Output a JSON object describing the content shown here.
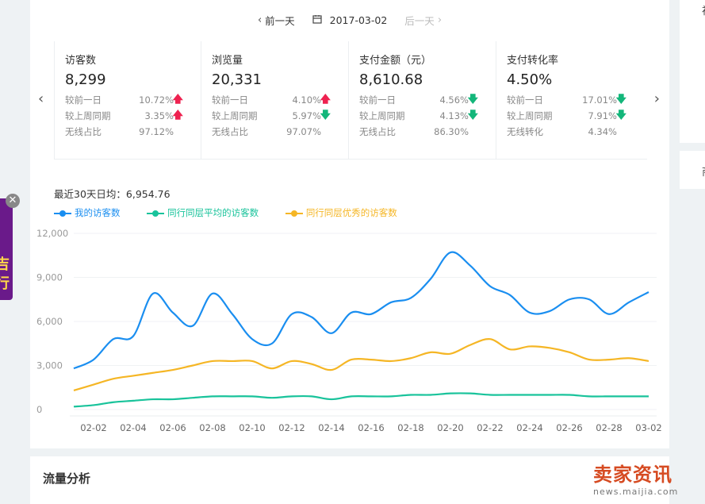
{
  "datenav": {
    "prev": "前一天",
    "date": "2017-03-02",
    "next": "后一天"
  },
  "kpis": [
    {
      "title": "访客数",
      "value": "8,299",
      "rows": [
        {
          "label": "较前一日",
          "value": "10.72%",
          "dir": "up"
        },
        {
          "label": "较上周同期",
          "value": "3.35%",
          "dir": "up"
        },
        {
          "label": "无线占比",
          "value": "97.12%",
          "dir": ""
        }
      ]
    },
    {
      "title": "浏览量",
      "value": "20,331",
      "rows": [
        {
          "label": "较前一日",
          "value": "4.10%",
          "dir": "up"
        },
        {
          "label": "较上周同期",
          "value": "5.97%",
          "dir": "down"
        },
        {
          "label": "无线占比",
          "value": "97.07%",
          "dir": ""
        }
      ]
    },
    {
      "title": "支付金额（元）",
      "value": "8,610.68",
      "rows": [
        {
          "label": "较前一日",
          "value": "4.56%",
          "dir": "down"
        },
        {
          "label": "较上周同期",
          "value": "4.13%",
          "dir": "down"
        },
        {
          "label": "无线占比",
          "value": "86.30%",
          "dir": ""
        }
      ]
    },
    {
      "title": "支付转化率",
      "value": "4.50%",
      "rows": [
        {
          "label": "较前一日",
          "value": "17.01%",
          "dir": "down"
        },
        {
          "label": "较上周同期",
          "value": "7.91%",
          "dir": "down"
        },
        {
          "label": "无线转化",
          "value": "4.34%",
          "dir": ""
        }
      ]
    }
  ],
  "avg": "最近30天日均：6,954.76",
  "section_title": "流量分析",
  "right_panel": {
    "t1": "衫",
    "t2": "商"
  },
  "ad_text": "吉\n行",
  "watermark": {
    "big": "卖家资讯",
    "small": "news.maijia.com"
  },
  "colors": {
    "mine": "#1a8ef0",
    "avg": "#19c39b",
    "best": "#f5b625",
    "up": "#ee2250",
    "down": "#13b67a"
  },
  "chart_data": {
    "type": "line",
    "ylim": [
      0,
      12000
    ],
    "yticks": [
      0,
      3000,
      6000,
      9000,
      12000
    ],
    "ytick_labels": [
      "0",
      "3,000",
      "6,000",
      "9,000",
      "12,000"
    ],
    "x": [
      "02-01",
      "02-02",
      "02-03",
      "02-04",
      "02-05",
      "02-06",
      "02-07",
      "02-08",
      "02-09",
      "02-10",
      "02-11",
      "02-12",
      "02-13",
      "02-14",
      "02-15",
      "02-16",
      "02-17",
      "02-18",
      "02-19",
      "02-20",
      "02-21",
      "02-22",
      "02-23",
      "02-24",
      "02-25",
      "02-26",
      "02-27",
      "02-28",
      "03-01",
      "03-02"
    ],
    "xtick_labels": [
      "02-02",
      "02-04",
      "02-06",
      "02-08",
      "02-10",
      "02-12",
      "02-14",
      "02-16",
      "02-18",
      "02-20",
      "02-22",
      "02-24",
      "02-26",
      "02-28",
      "03-02"
    ],
    "series": [
      {
        "name": "我的访客数",
        "color": "#1a8ef0",
        "values": [
          2800,
          3400,
          4800,
          5000,
          7900,
          6600,
          5700,
          7900,
          6500,
          4800,
          4500,
          6500,
          6300,
          5200,
          6600,
          6500,
          7300,
          7600,
          8900,
          10700,
          9800,
          8400,
          7800,
          6600,
          6700,
          7500,
          7500,
          6500,
          7300,
          8000
        ]
      },
      {
        "name": "同行同层平均的访客数",
        "color": "#19c39b",
        "values": [
          200,
          300,
          500,
          600,
          700,
          700,
          800,
          900,
          900,
          900,
          800,
          900,
          900,
          700,
          900,
          900,
          900,
          1000,
          1000,
          1100,
          1100,
          1000,
          1000,
          1000,
          1000,
          1000,
          900,
          900,
          900,
          900
        ]
      },
      {
        "name": "同行同层优秀的访客数",
        "color": "#f5b625",
        "values": [
          1300,
          1700,
          2100,
          2300,
          2500,
          2700,
          3000,
          3300,
          3300,
          3300,
          2800,
          3300,
          3100,
          2700,
          3400,
          3400,
          3300,
          3500,
          3900,
          3800,
          4400,
          4800,
          4100,
          4300,
          4200,
          3900,
          3400,
          3400,
          3500,
          3300
        ]
      }
    ]
  }
}
